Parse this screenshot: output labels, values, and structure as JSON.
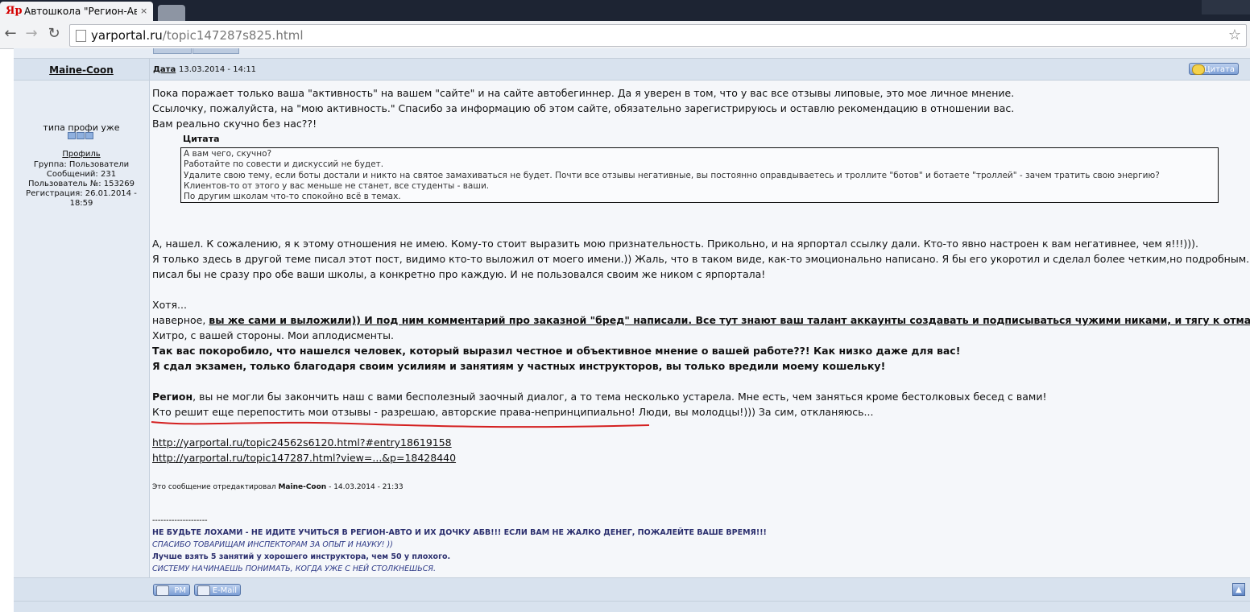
{
  "browser": {
    "tab_logo": "Яр",
    "tab_title": "Автошкола \"Регион-Авто",
    "tab_close": "×",
    "url_host": "yarportal.ru",
    "url_path": "/topic147287s825.html"
  },
  "post": {
    "author": "Maine-Coon",
    "date_label": "Дата",
    "date": "13.03.2014 - 14:11",
    "quote_button": "Цитата",
    "sidebar": {
      "rank": "типа профи уже",
      "profile_link": "Профиль",
      "group": "Группа: Пользователи",
      "messages": "Сообщений: 231",
      "user_no": "Пользователь №: 153269",
      "registered_1": "Регистрация: 26.01.2014 -",
      "registered_2": "18:59"
    },
    "intro_lines": [
      "Пока поражает только ваша \"активность\" на вашем \"сайте\" и на сайте автобегиннер. Да я уверен в том, что у вас все отзывы липовые, это мое личное мнение.",
      "Ссылочку, пожалуйста, на \"мою активность.\" Спасибо за информацию об этом сайте, обязательно зарегистрируюсь и оставлю рекомендацию в отношении вас.",
      "Вам реально скучно без нас??!"
    ],
    "quote_title": "Цитата",
    "quote_lines": [
      "А вам чего, скучно?",
      "Работайте по совести и дискуссий не будет.",
      "Удалите свою тему, если боты достали и никто на святое замахиваться не будет. Почти все отзывы негативные, вы постоянно оправдываетесь и троллите \"ботов\" и ботаете \"троллей\" - зачем тратить свою энергию?",
      "Клиентов-то от этого у вас меньше не станет, все студенты - ваши.",
      "По другим школам что-то спокойно всё в темах."
    ],
    "body_lines": [
      "А, нашел. К сожалению, я к этому отношения не имею. Кому-то стоит выразить мою признательность. Прикольно, и на ярпортал ссылку дали. Кто-то явно настроен к вам негативнее, чем я!!!))).",
      "Я только здесь в другой теме писал этот пост, видимо кто-то выложил от моего имени.)) Жаль, что в таком виде, как-то эмоционально написано. Я бы его укоротил и сделал более четким,но подробным. И",
      "писал бы не сразу про обе ваши школы, а конкретно про каждую. И не пользовался своим же ником с ярпортала!"
    ],
    "hotya": "Хотя...",
    "naverno_plain": "наверное, ",
    "naverno_bold": "вы же сами и выложили)) И под ним комментарий про заказной \"бред\" написали. Все тут знают ваш талант аккаунты создавать и подписываться чужими никами, и тягу к отмазкам.",
    "hitro": "Хитро, с вашей стороны. Мои аплодисменты.",
    "bold_1": "Так вас покоробило, что нашелся человек, который выразил честное и объективное мнение о вашей работе??! Как низко даже для вас!",
    "bold_2": "Я сдал экзамен, только благодаря своим усилиям и занятиям у частных инструкторов, вы только вредили моему кошельку!",
    "region_bold": "Регион",
    "region_rest": ", вы не могли бы закончить наш с вами бесполезный заочный диалог, а то тема несколько устарела. Мне есть, чем заняться кроме бестолковых бесед с вами!",
    "repost_line": "Кто решит еще перепостить мои отзывы - разрешаю, авторские права-непринципиально! Люди, вы молодцы!))) За сим, откланяюсь...",
    "link_1": "http://yarportal.ru/topic24562s6120.html?#entry18619158",
    "link_2": "http://yarportal.ru/topic147287.html?view=...&p=18428440",
    "edited_prefix": "Это сообщение отредактировал ",
    "edited_author": "Maine-Coon",
    "edited_suffix": " - 14.03.2014 - 21:33",
    "sig_divider": "--------------------",
    "sig_1": "НЕ БУДЬТЕ ЛОХАМИ - НЕ ИДИТЕ УЧИТЬСЯ В РЕГИОН-АВТО И ИХ ДОЧКУ АБВ!!! ЕСЛИ ВАМ НЕ ЖАЛКО ДЕНЕГ, ПОЖАЛЕЙТЕ ВАШЕ ВРЕМЯ!!!",
    "sig_2": "СПАСИБО ТОВАРИЩАМ ИНСПЕКТОРАМ ЗА ОПЫТ И НАУКУ! ))",
    "sig_3": "Лучше взять 5 занятий у хорошего инструктора, чем 50 у плохого.",
    "sig_4": "СИСТЕМУ НАЧИНАЕШЬ ПОНИМАТЬ, КОГДА УЖЕ С НЕЙ СТОЛКНЕШЬСЯ.",
    "pm_button": "PM",
    "email_button": "E-Mail"
  },
  "colors": {
    "red_underline": "#d42020",
    "sig_blue": "#2b2f6e"
  }
}
